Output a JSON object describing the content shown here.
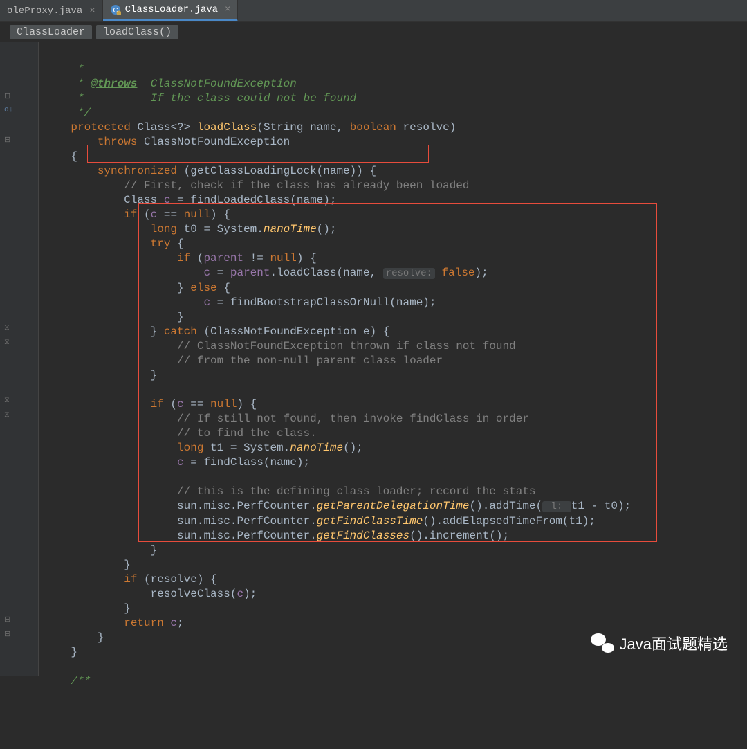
{
  "tabs": [
    {
      "label": "oleProxy.java",
      "active": false
    },
    {
      "label": "ClassLoader.java",
      "active": true
    }
  ],
  "breadcrumb": [
    "ClassLoader",
    "loadClass()"
  ],
  "code": {
    "l1": " *",
    "l2a": " * ",
    "l2b": "@throws",
    "l2c": "  ClassNotFoundException",
    "l3a": " *",
    "l3b": "          If the class could not be found",
    "l4": " */",
    "l5a": "protected",
    "l5b": " Class<?> ",
    "l5c": "loadClass",
    "l5d": "(String name, ",
    "l5e": "boolean",
    "l5f": " resolve)",
    "l6a": "    throws",
    "l6b": " ClassNotFoundException",
    "l7": "{",
    "l8a": "    synchronized",
    "l8b": " (getClassLoadingLock(name)) {",
    "l9": "        // First, check if the class has already been loaded",
    "l10a": "        Class ",
    "l10b": "c",
    "l10c": " = findLoadedClass(name);",
    "l11a": "        if",
    "l11b": " (",
    "l11c": "c",
    "l11d": " == ",
    "l11e": "null",
    "l11f": ") {",
    "l12a": "            long",
    "l12b": " t0 = System.",
    "l12c": "nanoTime",
    "l12d": "();",
    "l13a": "            try",
    "l13b": " {",
    "l14a": "                if",
    "l14b": " (",
    "l14c": "parent",
    "l14d": " != ",
    "l14e": "null",
    "l14f": ") {",
    "l15a": "                    c",
    "l15b": " = ",
    "l15c": "parent",
    "l15d": ".loadClass(name, ",
    "l15h": "resolve:",
    "l15e": " false",
    "l15f": ");",
    "l16a": "                } ",
    "l16b": "else",
    "l16c": " {",
    "l17a": "                    c",
    "l17b": " = findBootstrapClassOrNull(name);",
    "l18": "                }",
    "l19a": "            } ",
    "l19b": "catch",
    "l19c": " (ClassNotFoundException e) {",
    "l20": "                // ClassNotFoundException thrown if class not found",
    "l21": "                // from the non-null parent class loader",
    "l22": "            }",
    "l23": "",
    "l24a": "            if",
    "l24b": " (",
    "l24c": "c",
    "l24d": " == ",
    "l24e": "null",
    "l24f": ") {",
    "l25": "                // If still not found, then invoke findClass in order",
    "l26": "                // to find the class.",
    "l27a": "                long",
    "l27b": " t1 = System.",
    "l27c": "nanoTime",
    "l27d": "();",
    "l28a": "                c",
    "l28b": " = findClass(name);",
    "l29": "",
    "l30": "                // this is the defining class loader; record the stats",
    "l31a": "                sun.misc.PerfCounter.",
    "l31b": "getParentDelegationTime",
    "l31c": "().addTime(",
    "l31h": " l: ",
    "l31d": "t1 - t0);",
    "l32a": "                sun.misc.PerfCounter.",
    "l32b": "getFindClassTime",
    "l32c": "().addElapsedTimeFrom(t1);",
    "l33a": "                sun.misc.PerfCounter.",
    "l33b": "getFindClasses",
    "l33c": "().increment();",
    "l34": "            }",
    "l35": "        }",
    "l36a": "        if",
    "l36b": " (resolve) {",
    "l37a": "            resolveClass(",
    "l37b": "c",
    "l37c": ");",
    "l38": "        }",
    "l39a": "        return",
    "l39b": " c",
    "l39c": ";",
    "l40": "    }",
    "l41": "}",
    "l42": "",
    "l43": "/**"
  },
  "watermark": "Java面试题精选"
}
